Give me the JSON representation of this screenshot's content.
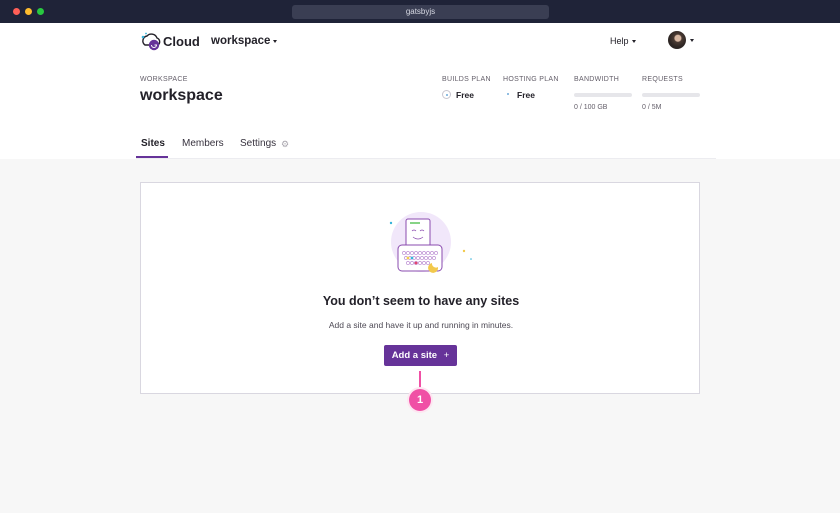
{
  "window": {
    "url": "gatsbyjs"
  },
  "header": {
    "logo_text": "Cloud",
    "workspace_selector": "workspace",
    "help_label": "Help"
  },
  "workspace": {
    "label": "WORKSPACE",
    "name": "workspace"
  },
  "plans": {
    "builds": {
      "label": "BUILDS PLAN",
      "value": "Free"
    },
    "hosting": {
      "label": "HOSTING PLAN",
      "value": "Free"
    }
  },
  "usage": {
    "bandwidth": {
      "label": "BANDWIDTH",
      "value": "0 / 100 GB",
      "fraction": 0
    },
    "requests": {
      "label": "REQUESTS",
      "value": "0 / 5M",
      "fraction": 0
    }
  },
  "tabs": [
    {
      "label": "Sites",
      "active": true
    },
    {
      "label": "Members",
      "active": false
    },
    {
      "label": "Settings",
      "active": false
    }
  ],
  "empty_state": {
    "title": "You don’t seem to have any sites",
    "subtitle": "Add a site and have it up and running in minutes.",
    "button_label": "Add a site",
    "button_icon": "plus-icon"
  },
  "annotation": {
    "number": "1"
  },
  "colors": {
    "accent": "#663399",
    "marker": "#f050a5",
    "chrome": "#1f2338"
  }
}
